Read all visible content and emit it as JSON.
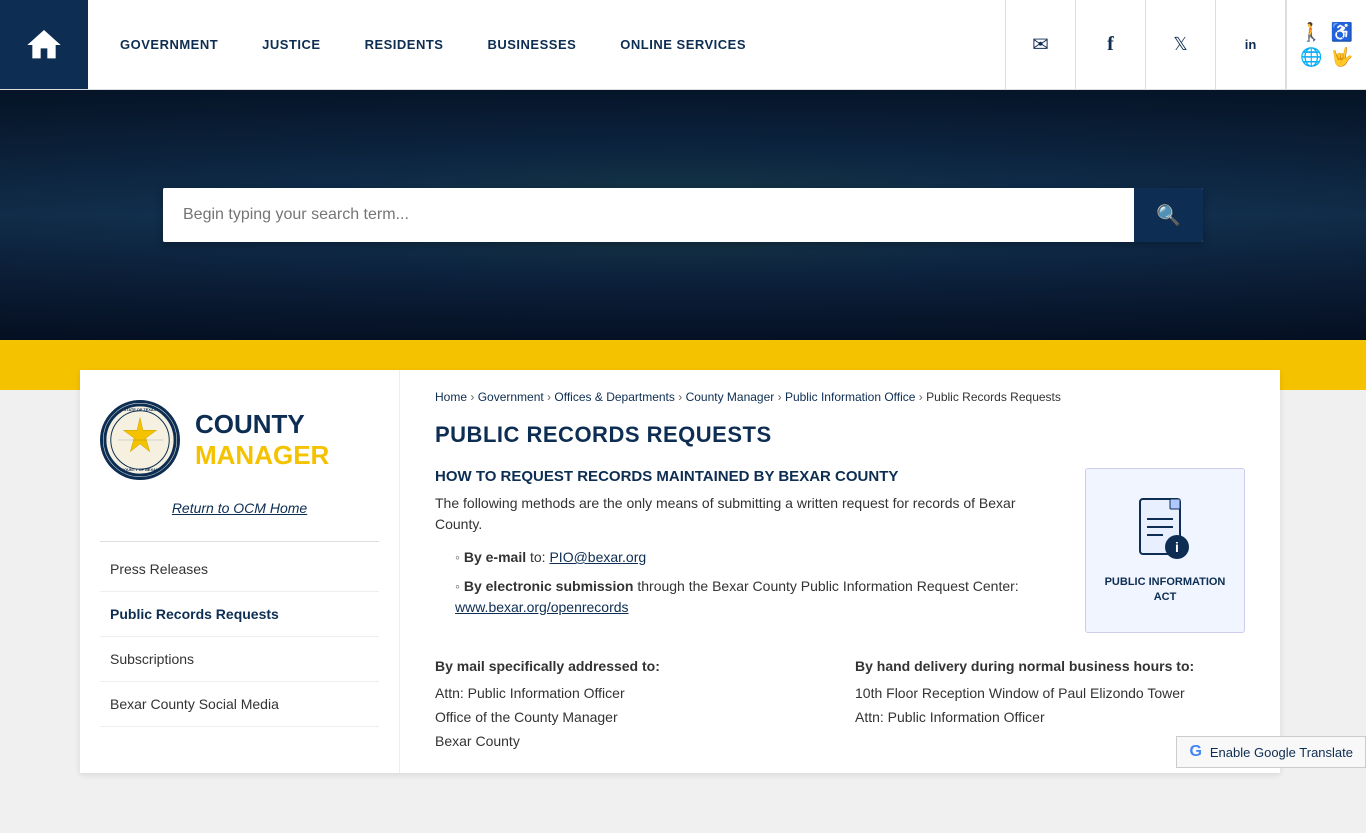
{
  "nav": {
    "links": [
      {
        "label": "GOVERNMENT",
        "href": "#"
      },
      {
        "label": "JUSTICE",
        "href": "#"
      },
      {
        "label": "RESIDENTS",
        "href": "#"
      },
      {
        "label": "BUSINESSES",
        "href": "#"
      },
      {
        "label": "ONLINE SERVICES",
        "href": "#"
      }
    ],
    "social": [
      {
        "name": "email",
        "icon": "✉",
        "label": "Email"
      },
      {
        "name": "facebook",
        "icon": "f",
        "label": "Facebook"
      },
      {
        "name": "twitter",
        "icon": "𝕏",
        "label": "Twitter"
      },
      {
        "name": "linkedin",
        "icon": "in",
        "label": "LinkedIn"
      }
    ]
  },
  "search": {
    "placeholder": "Begin typing your search term...",
    "button_label": "🔍"
  },
  "sidebar": {
    "logo_text_county": "COUNTY",
    "logo_text_manager": "MANAGER",
    "return_link": "Return to OCM Home",
    "menu_items": [
      {
        "label": "Press Releases",
        "active": false
      },
      {
        "label": "Public Records Requests",
        "active": true
      },
      {
        "label": "Subscriptions",
        "active": false
      },
      {
        "label": "Bexar County Social Media",
        "active": false
      }
    ]
  },
  "breadcrumb": {
    "items": [
      {
        "label": "Home",
        "href": "#"
      },
      {
        "label": "Government",
        "href": "#"
      },
      {
        "label": "Offices & Departments",
        "href": "#"
      },
      {
        "label": "County Manager",
        "href": "#"
      },
      {
        "label": "Public Information Office",
        "href": "#"
      },
      {
        "label": "Public Records Requests",
        "current": true
      }
    ]
  },
  "page_title": "PUBLIC RECORDS REQUESTS",
  "content": {
    "section1_heading": "HOW TO REQUEST RECORDS MAINTAINED BY BEXAR COUNTY",
    "section1_text": "The following methods are the only means of submitting a written request for records of Bexar County.",
    "bullet1_label": "By e-mail",
    "bullet1_text": " to: ",
    "bullet1_link": "PIO@bexar.org",
    "bullet2_label": "By electronic submission",
    "bullet2_text": " through the Bexar County Public Information Request Center: ",
    "bullet2_link": "www.bexar.org/openrecords",
    "pia_label": "PUBLIC\nINFORMATION\nACT",
    "mail_heading": "By mail specifically addressed to:",
    "mail_line1": "Attn: Public Information Officer",
    "mail_line2": "Office of the County Manager",
    "mail_line3": "Bexar County",
    "hand_heading": "By hand delivery during normal business hours to:",
    "hand_line1": "10th Floor Reception Window of Paul Elizondo Tower",
    "hand_line2": "",
    "hand_line3": "Attn: Public Information Officer"
  },
  "translate": {
    "label": "Enable Google Translate"
  }
}
